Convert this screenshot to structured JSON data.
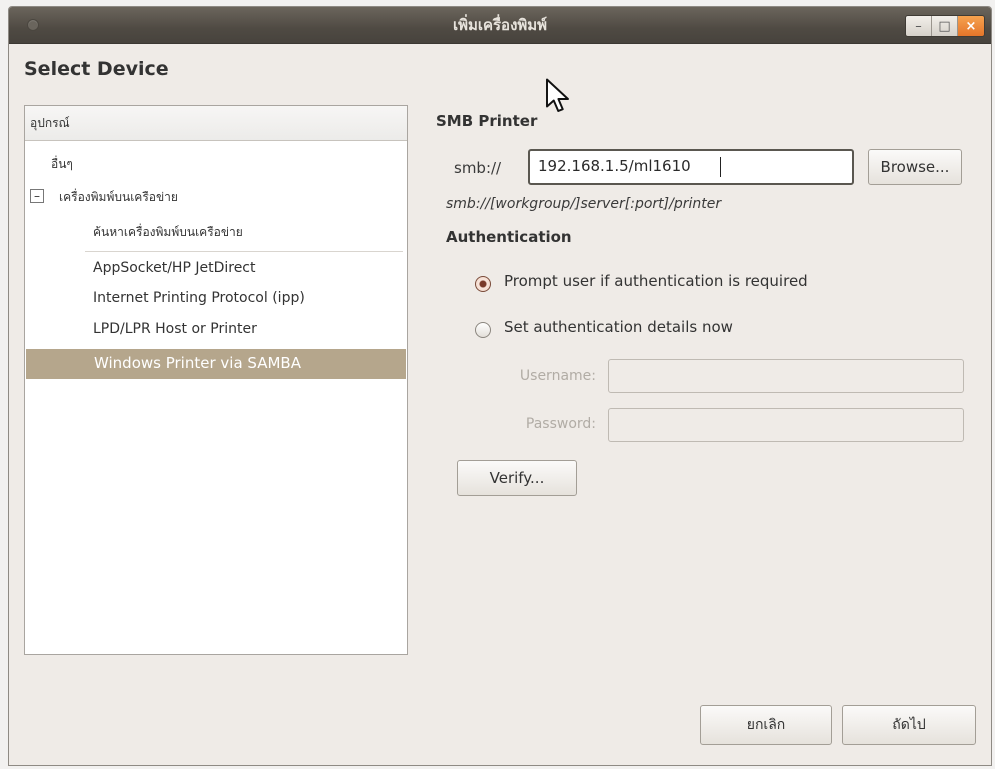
{
  "window": {
    "title": "เพิ่มเครื่องพิมพ์",
    "controls": {
      "minimize": "–",
      "maximize": "□",
      "close": "×"
    }
  },
  "page": {
    "heading": "Select Device"
  },
  "device_list": {
    "header": "อุปกรณ์",
    "other": "อื่นๆ",
    "network_group": "เครื่องพิมพ์บนเครือข่าย",
    "tree_toggle": "–",
    "find_network": "ค้นหาเครื่องพิมพ์บนเครือข่าย",
    "items": [
      "AppSocket/HP JetDirect",
      "Internet Printing Protocol (ipp)",
      "LPD/LPR Host or Printer"
    ],
    "selected_item": "Windows Printer via SAMBA"
  },
  "smb": {
    "title": "SMB Printer",
    "prefix": "smb://",
    "value": "192.168.1.5/ml1610",
    "browse_label": "Browse...",
    "hint": "smb://[workgroup/]server[:port]/printer"
  },
  "auth": {
    "title": "Authentication",
    "option_prompt": "Prompt user if authentication is required",
    "option_set": "Set authentication details now",
    "username_label": "Username:",
    "password_label": "Password:",
    "verify_label": "Verify..."
  },
  "footer": {
    "cancel_label": "ยกเลิก",
    "next_label": "ถัดไป"
  }
}
